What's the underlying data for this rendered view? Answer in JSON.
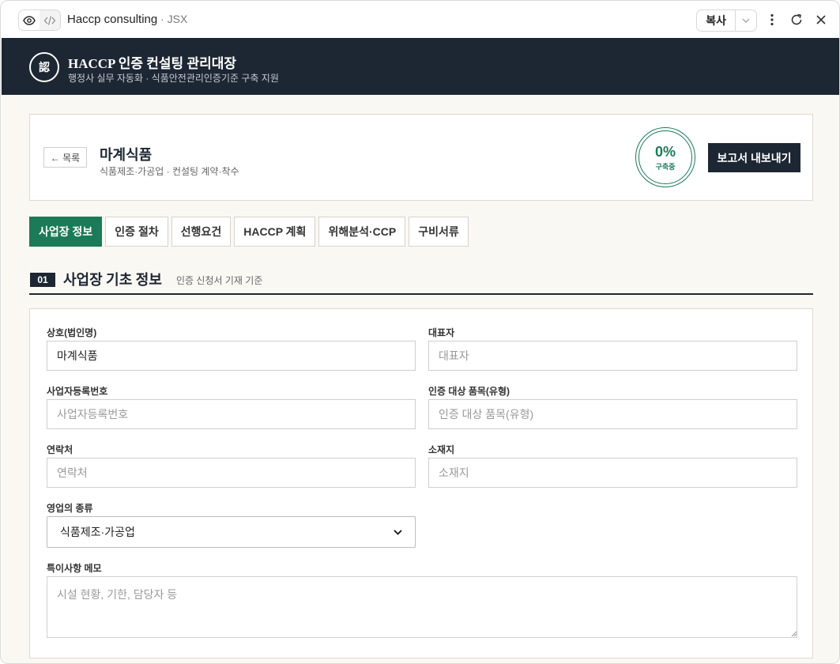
{
  "appbar": {
    "title": "Haccp consulting",
    "subtitle": " · JSX",
    "copy_label": "복사"
  },
  "header": {
    "logo_text": "認",
    "title": "HACCP 인증 컨설팅 관리대장",
    "subtitle": "행정사 실무 자동화 · 식품안전관리인증기준 구축 지원"
  },
  "company": {
    "back_label": "← 목록",
    "name": "마계식품",
    "meta": "식품제조·가공업 · 컨설팅 계약·착수",
    "progress_pct": "0%",
    "progress_status": "구축중",
    "progress_value": 0,
    "export_label": "보고서 내보내기"
  },
  "tabs": [
    {
      "label": "사업장 정보",
      "active": true
    },
    {
      "label": "인증 절차",
      "active": false
    },
    {
      "label": "선행요건",
      "active": false
    },
    {
      "label": "HACCP 계획",
      "active": false
    },
    {
      "label": "위해분석·CCP",
      "active": false
    },
    {
      "label": "구비서류",
      "active": false
    }
  ],
  "section": {
    "number": "01",
    "title": "사업장 기초 정보",
    "subtitle": "인증 신청서 기재 기준"
  },
  "form": {
    "company_name": {
      "label": "상호(법인명)",
      "value": "마계식품",
      "placeholder": "상호(법인명)"
    },
    "ceo": {
      "label": "대표자",
      "value": "",
      "placeholder": "대표자"
    },
    "biz_no": {
      "label": "사업자등록번호",
      "value": "",
      "placeholder": "사업자등록번호"
    },
    "item": {
      "label": "인증 대상 품목(유형)",
      "value": "",
      "placeholder": "인증 대상 품목(유형)"
    },
    "phone": {
      "label": "연락처",
      "value": "",
      "placeholder": "연락처"
    },
    "address": {
      "label": "소재지",
      "value": "",
      "placeholder": "소재지"
    },
    "biz_type": {
      "label": "영업의 종류",
      "value": "식품제조·가공업"
    },
    "memo": {
      "label": "특이사항 메모",
      "value": "",
      "placeholder": "시설 현황, 기한, 담당자 등"
    }
  },
  "colors": {
    "accent": "#1b7a57",
    "navy": "#1d2733",
    "page_bg": "#faf8f3"
  }
}
